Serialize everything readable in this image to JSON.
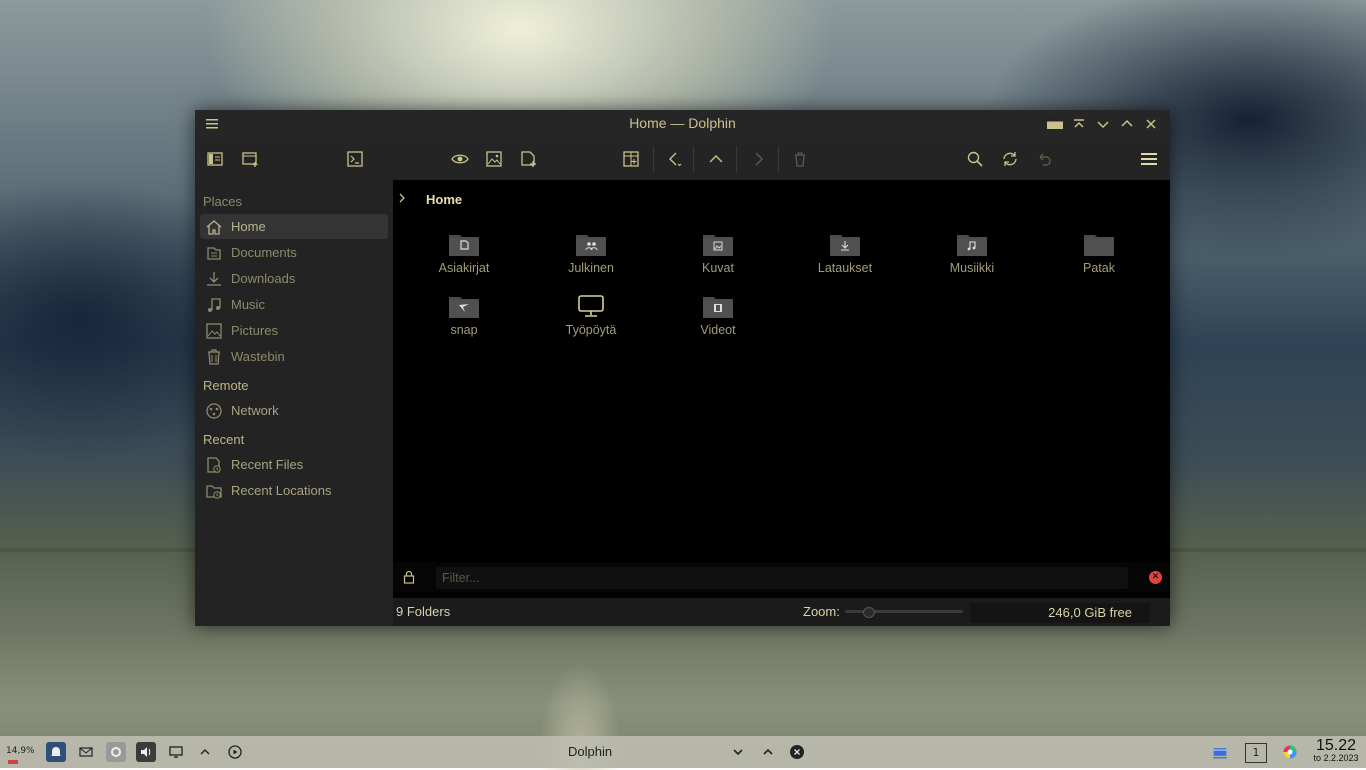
{
  "window": {
    "title": "Home — Dolphin"
  },
  "sidebar": {
    "sections": [
      {
        "label": "Places"
      },
      {
        "label": "Remote"
      },
      {
        "label": "Recent"
      }
    ],
    "places": [
      {
        "label": "Home",
        "icon": "home-icon"
      },
      {
        "label": "Documents",
        "icon": "documents-icon"
      },
      {
        "label": "Downloads",
        "icon": "downloads-icon"
      },
      {
        "label": "Music",
        "icon": "music-icon"
      },
      {
        "label": "Pictures",
        "icon": "pictures-icon"
      },
      {
        "label": "Wastebin",
        "icon": "wastebin-icon"
      }
    ],
    "remote": [
      {
        "label": "Network",
        "icon": "network-icon"
      }
    ],
    "recent": [
      {
        "label": "Recent Files",
        "icon": "recent-files-icon"
      },
      {
        "label": "Recent Locations",
        "icon": "recent-locations-icon"
      }
    ]
  },
  "breadcrumb": {
    "current": "Home"
  },
  "files": [
    {
      "name": "Asiakirjat",
      "icon": "documents-folder-icon"
    },
    {
      "name": "Julkinen",
      "icon": "public-folder-icon"
    },
    {
      "name": "Kuvat",
      "icon": "pictures-folder-icon"
    },
    {
      "name": "Lataukset",
      "icon": "downloads-folder-icon"
    },
    {
      "name": "Musiikki",
      "icon": "music-folder-icon"
    },
    {
      "name": "Patak",
      "icon": "folder-icon"
    },
    {
      "name": "snap",
      "icon": "snap-folder-icon"
    },
    {
      "name": "Työpöytä",
      "icon": "desktop-icon"
    },
    {
      "name": "Videot",
      "icon": "videos-folder-icon"
    }
  ],
  "filter": {
    "placeholder": "Filter...",
    "value": ""
  },
  "status": {
    "summary": "9 Folders",
    "zoom_label": "Zoom:",
    "zoom_level": 0.15,
    "free_space": "246,0 GiB free"
  },
  "taskbar": {
    "cpu": "14,9%",
    "active_task": "Dolphin",
    "desktop_number": "1",
    "time": "15.22",
    "date": "to 2.2.2023"
  },
  "colors": {
    "accent_text": "#c9c28a",
    "muted_text": "#8e8a6c",
    "folder": "#4a4a4a",
    "clear_button": "#e0443e"
  }
}
